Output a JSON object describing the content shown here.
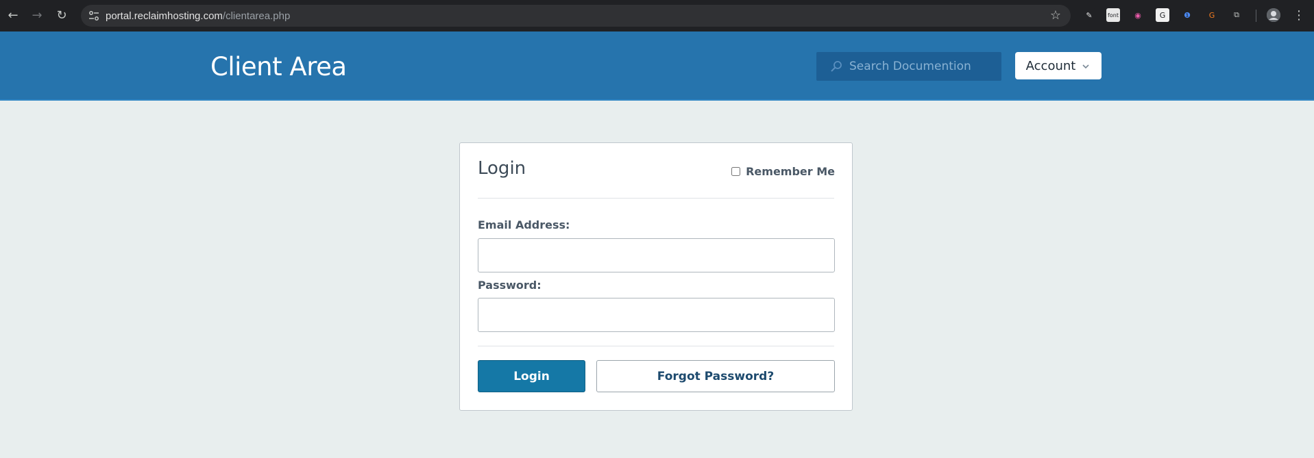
{
  "browser": {
    "url_host": "portal.reclaimhosting.com",
    "url_path": "/clientarea.php",
    "back_icon": "←",
    "forward_icon": "→",
    "reload_icon": "↻",
    "star_icon": "☆",
    "extensions": [
      {
        "name": "eyedropper-icon",
        "glyph": "✎",
        "bg": "#202124",
        "fg": "#e3e3e3"
      },
      {
        "name": "font-extension-icon",
        "glyph": "font",
        "bg": "#e8e8e8",
        "fg": "#202124"
      },
      {
        "name": "color-wheel-icon",
        "glyph": "◉",
        "bg": "#202124",
        "fg": "#e85aa8"
      },
      {
        "name": "grammarly-icon",
        "glyph": "G",
        "bg": "#f1f1f1",
        "fg": "#202124"
      },
      {
        "name": "password-manager-icon",
        "glyph": "❶",
        "bg": "#202124",
        "fg": "#4b8af5"
      },
      {
        "name": "swirl-extension-icon",
        "glyph": "G",
        "bg": "#202124",
        "fg": "#f57c1f"
      },
      {
        "name": "puzzle-icon",
        "glyph": "⧉",
        "bg": "#202124",
        "fg": "#c4c7c5"
      }
    ],
    "menu_icon": "⋮"
  },
  "header": {
    "title": "Client Area",
    "search_placeholder": "Search Documention",
    "account_label": "Account",
    "account_chevron": "⌄",
    "colors": {
      "background": "#2674ad",
      "search_bg": "#1d5f95"
    }
  },
  "login": {
    "title": "Login",
    "remember_label": "Remember Me",
    "remember_checked": false,
    "email_label": "Email Address:",
    "email_value": "",
    "password_label": "Password:",
    "password_value": "",
    "login_button": "Login",
    "forgot_button": "Forgot Password?",
    "colors": {
      "primary": "#1578a6",
      "page_bg": "#e8eeee"
    }
  }
}
